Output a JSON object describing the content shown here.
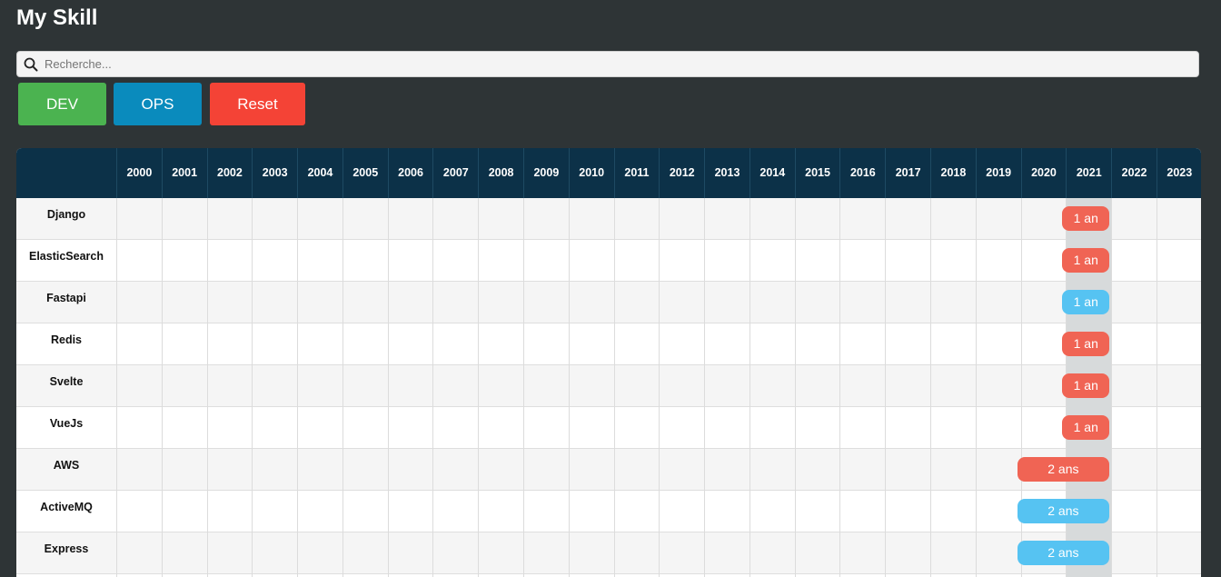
{
  "page": {
    "title": "My Skill"
  },
  "search": {
    "placeholder": "Recherche...",
    "icon": "search-icon"
  },
  "filters": {
    "dev_label": "DEV",
    "ops_label": "OPS",
    "reset_label": "Reset"
  },
  "colors": {
    "dev": "#f06454",
    "ops": "#56c3f2",
    "dev_button": "#4bb350",
    "ops_button": "#0a8bbd",
    "reset_button": "#f44336",
    "header": "#0c3148",
    "highlight_year": "2021"
  },
  "timeline": {
    "years": [
      "2000",
      "2001",
      "2002",
      "2003",
      "2004",
      "2005",
      "2006",
      "2007",
      "2008",
      "2009",
      "2010",
      "2011",
      "2012",
      "2013",
      "2014",
      "2015",
      "2016",
      "2017",
      "2018",
      "2019",
      "2020",
      "2021",
      "2022",
      "2023"
    ],
    "current_year": "2021",
    "skills": [
      {
        "name": "Django",
        "category": "dev",
        "start": "2021",
        "end": "2021",
        "label": "1 an"
      },
      {
        "name": "ElasticSearch",
        "category": "dev",
        "start": "2021",
        "end": "2021",
        "label": "1 an"
      },
      {
        "name": "Fastapi",
        "category": "ops",
        "start": "2021",
        "end": "2021",
        "label": "1 an"
      },
      {
        "name": "Redis",
        "category": "dev",
        "start": "2021",
        "end": "2021",
        "label": "1 an"
      },
      {
        "name": "Svelte",
        "category": "dev",
        "start": "2021",
        "end": "2021",
        "label": "1 an"
      },
      {
        "name": "VueJs",
        "category": "dev",
        "start": "2021",
        "end": "2021",
        "label": "1 an"
      },
      {
        "name": "AWS",
        "category": "dev",
        "start": "2020",
        "end": "2021",
        "label": "2 ans"
      },
      {
        "name": "ActiveMQ",
        "category": "ops",
        "start": "2020",
        "end": "2021",
        "label": "2 ans"
      },
      {
        "name": "Express",
        "category": "ops",
        "start": "2020",
        "end": "2021",
        "label": "2 ans"
      }
    ]
  }
}
